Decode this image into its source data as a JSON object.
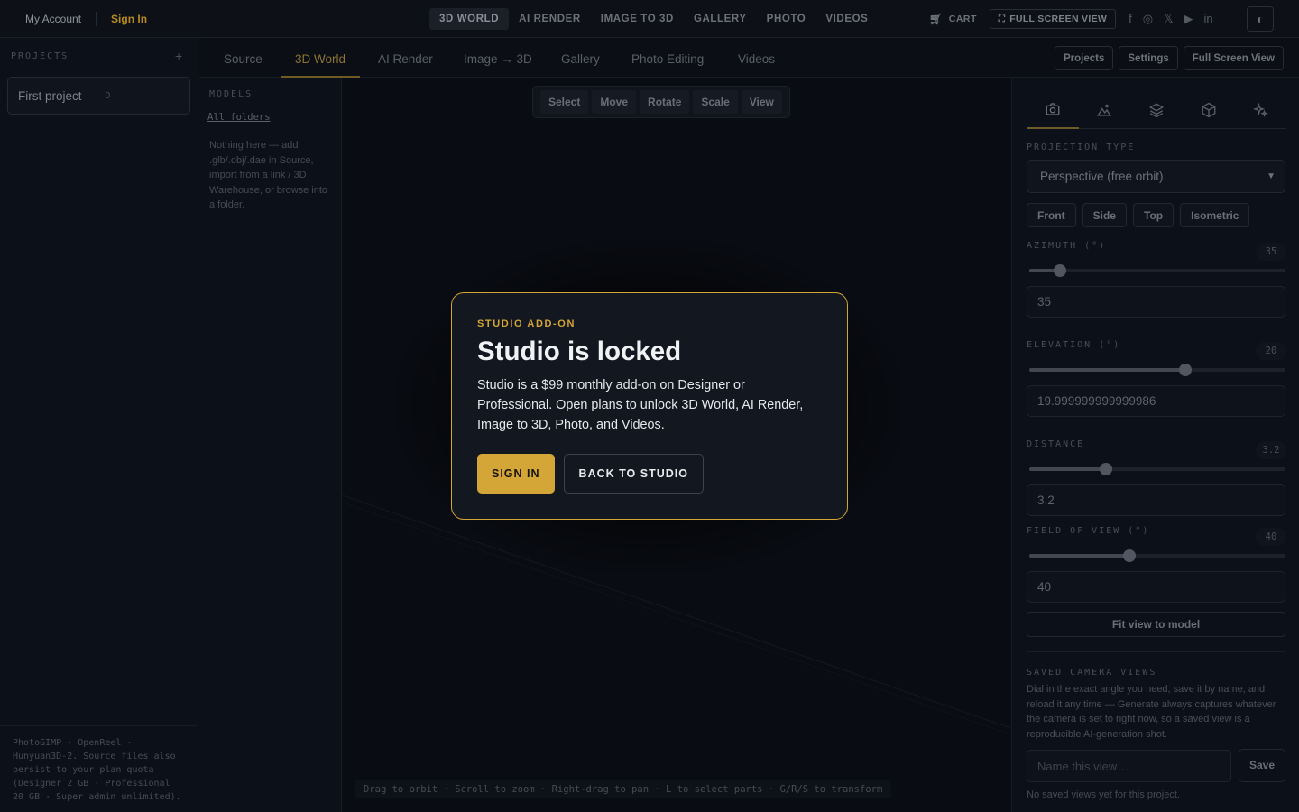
{
  "topbar": {
    "account_label": "My Account",
    "signin_label": "Sign In",
    "nav": [
      "3D WORLD",
      "AI RENDER",
      "IMAGE TO 3D",
      "GALLERY",
      "PHOTO",
      "VIDEOS"
    ],
    "active_nav": "3D WORLD",
    "cart_label": "CART",
    "fullscreen_label": "FULL SCREEN VIEW",
    "socials": [
      "facebook-icon",
      "instagram-icon",
      "x-icon",
      "youtube-icon",
      "linkedin-icon"
    ],
    "theme_icon": "contrast-icon"
  },
  "projects": {
    "header": "PROJECTS",
    "add_label": "+",
    "items": [
      {
        "name": "First project",
        "count": "0"
      }
    ],
    "footnote": "PhotoGIMP · OpenReel · Hunyuan3D-2. Source files also persist to your plan quota (Designer 2 GB · Professional 20 GB · Super admin unlimited)."
  },
  "tabs": {
    "items": [
      "Source",
      "3D World",
      "AI Render",
      "Image → 3D",
      "Gallery",
      "Photo Editing",
      "Videos"
    ],
    "active": "3D World"
  },
  "header_buttons": [
    "Projects",
    "Settings",
    "Full Screen View"
  ],
  "models": {
    "header": "MODELS",
    "all_folders_label": "All folders",
    "empty_text": "Nothing here — add .glb/.obj/.dae in Source, import from a link / 3D Warehouse, or browse into a folder."
  },
  "viewport": {
    "tools": [
      "Select",
      "Move",
      "Rotate",
      "Scale",
      "View"
    ],
    "hint": "Drag to orbit · Scroll to zoom · Right-drag to pan · L to select parts · G/R/S to transform"
  },
  "camera": {
    "tab_icons": [
      "camera-icon",
      "terrain-icon",
      "layers-icon",
      "cube-icon",
      "sparkles-icon"
    ],
    "projection_label": "PROJECTION TYPE",
    "projection_value": "Perspective (free orbit)",
    "view_buttons": [
      "Front",
      "Side",
      "Top",
      "Isometric"
    ],
    "azimuth": {
      "label": "AZIMUTH (°)",
      "badge": "35",
      "input": "35",
      "fraction": 0.12
    },
    "elevation": {
      "label": "ELEVATION (°)",
      "badge": "20",
      "input": "19.999999999999986",
      "fraction": 0.61
    },
    "distance": {
      "label": "DISTANCE",
      "badge": "3.2",
      "input": "3.2",
      "fraction": 0.3
    },
    "fov": {
      "label": "FIELD OF VIEW (°)",
      "badge": "40",
      "input": "40",
      "fraction": 0.39
    },
    "fit_label": "Fit view to model",
    "saved_label": "SAVED CAMERA VIEWS",
    "saved_desc": "Dial in the exact angle you need, save it by name, and reload it any time — Generate always captures whatever the camera is set to right now, so a saved view is a reproducible AI-generation shot.",
    "name_placeholder": "Name this view…",
    "save_label": "Save",
    "no_saved": "No saved views yet for this project."
  },
  "modal": {
    "eyebrow": "STUDIO ADD-ON",
    "title": "Studio is locked",
    "description": "Studio is a $99 monthly add-on on Designer or Professional. Open plans to unlock 3D World, AI Render, Image to 3D, Photo, and Videos.",
    "primary_label": "SIGN IN",
    "secondary_label": "BACK TO STUDIO"
  },
  "colors": {
    "accent": "#d4a537",
    "background": "#0b0e14"
  }
}
